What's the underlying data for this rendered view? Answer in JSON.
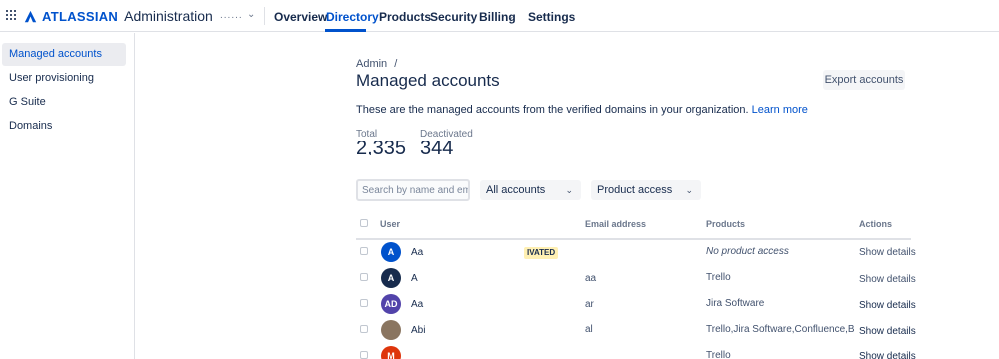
{
  "nav": {
    "brand": "ATLASSIAN",
    "product": "Administration",
    "org_name": "......",
    "items": [
      {
        "label": "Overview"
      },
      {
        "label": "Directory"
      },
      {
        "label": "Products"
      },
      {
        "label": "Security"
      },
      {
        "label": "Billing"
      },
      {
        "label": "Settings"
      }
    ],
    "active_item": "Directory",
    "accent_color": "#0052CC"
  },
  "sidebar": {
    "items": [
      {
        "label": "Managed accounts"
      },
      {
        "label": "User provisioning"
      },
      {
        "label": "G Suite"
      },
      {
        "label": "Domains"
      }
    ],
    "selected": "Managed accounts"
  },
  "main": {
    "breadcrumb": "Admin",
    "breadcrumb_separator": "/",
    "title": "Managed accounts",
    "export_button": "Export accounts",
    "description": "These are the managed accounts from the verified domains in your organization.",
    "learn_more": "Learn more",
    "stats": [
      {
        "label": "Total",
        "value": "2,335"
      },
      {
        "label": "Deactivated",
        "value": "344"
      }
    ],
    "search_placeholder": "Search by name and email",
    "filters": {
      "accounts": "All accounts",
      "product": "Product access"
    }
  },
  "table": {
    "headers": [
      "User",
      "Email address",
      "Products",
      "Actions"
    ],
    "rows": [
      {
        "initials": "A",
        "avatar_color": "#0052CC",
        "name": "Aa",
        "email": "",
        "products": "No product access",
        "action": "Show details",
        "badge": "IVATED"
      },
      {
        "initials": "A",
        "avatar_color": "#172B4D",
        "name": "A",
        "email": "aa",
        "products": "Trello",
        "action": "Show details"
      },
      {
        "initials": "AD",
        "avatar_color": "#5243AA",
        "name": "Aa",
        "email": "ar",
        "products": "Jira Software",
        "action": "Show details"
      },
      {
        "initials": "",
        "avatar_color": "#8a7560",
        "name": "Abi",
        "email": "al",
        "products": "Trello,Jira Software,Confluence,Bi...",
        "action": "Show details"
      },
      {
        "initials": "M",
        "avatar_color": "#DE350B",
        "name": "",
        "email": "",
        "products": "Trello",
        "action": "Show details"
      }
    ]
  }
}
